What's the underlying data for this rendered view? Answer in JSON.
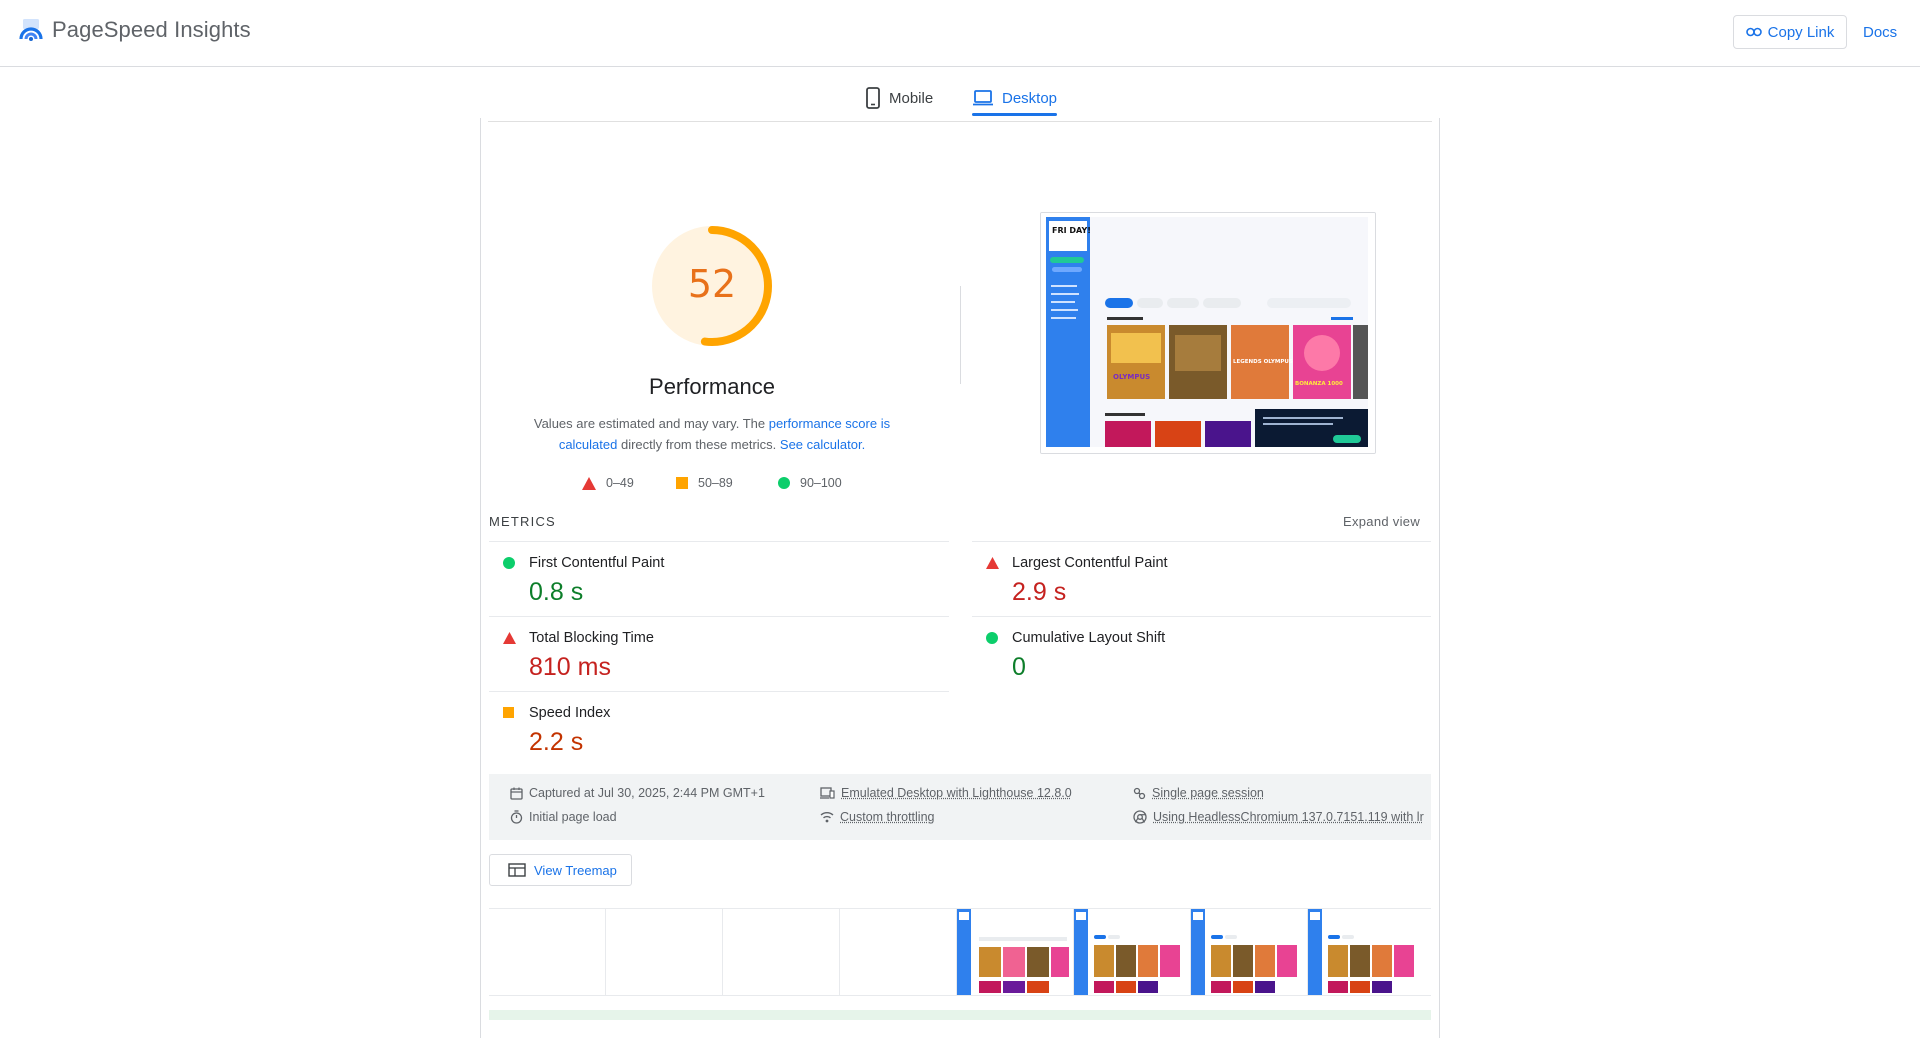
{
  "header": {
    "app_title": "PageSpeed Insights",
    "copy_link_label": "Copy Link",
    "docs_label": "Docs"
  },
  "tabs": [
    {
      "label": "Mobile",
      "selected": false
    },
    {
      "label": "Desktop",
      "selected": true
    }
  ],
  "performance": {
    "score": "52",
    "score_value": 52,
    "title": "Performance",
    "desc_prefix": "Values are estimated and may vary. The ",
    "desc_link1": "performance score is calculated",
    "desc_middle": " directly from these metrics. ",
    "desc_link2": "See calculator.",
    "colors": {
      "fail": "#e53935",
      "average": "#ffa400",
      "pass": "#0cce6b"
    }
  },
  "legend": [
    {
      "shape": "triangle",
      "label": "0–49"
    },
    {
      "shape": "square",
      "label": "50–89"
    },
    {
      "shape": "circle",
      "label": "90–100"
    }
  ],
  "metrics_section": {
    "header": "METRICS",
    "expand_label": "Expand view",
    "items": [
      {
        "name": "First Contentful Paint",
        "value": "0.8 s",
        "rating": "pass"
      },
      {
        "name": "Largest Contentful Paint",
        "value": "2.9 s",
        "rating": "fail"
      },
      {
        "name": "Total Blocking Time",
        "value": "810 ms",
        "rating": "fail"
      },
      {
        "name": "Cumulative Layout Shift",
        "value": "0",
        "rating": "pass"
      },
      {
        "name": "Speed Index",
        "value": "2.2 s",
        "rating": "average"
      }
    ]
  },
  "runtime_info": {
    "captured": "Captured at Jul 30, 2025, 2:44 PM GMT+1",
    "load": "Initial page load",
    "emulation": "Emulated Desktop with Lighthouse 12.8.0",
    "throttling": "Custom throttling",
    "session": "Single page session",
    "browser": "Using HeadlessChromium 137.0.7151.119 with lr"
  },
  "treemap_label": "View Treemap",
  "thumbnail": {
    "site_logo": "FRI DAY!",
    "games": [
      "OLYMPUS",
      "LEGENDS OLYMPUS",
      "BONANZA 1000"
    ]
  }
}
